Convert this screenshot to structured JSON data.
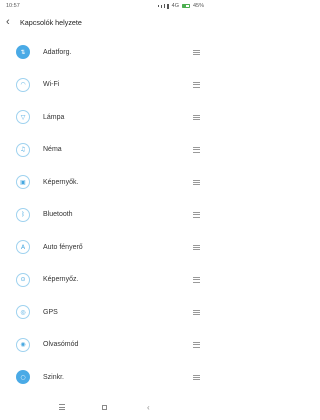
{
  "status_bar": {
    "time": "10:57",
    "network": "4G",
    "battery": "45%"
  },
  "header": {
    "back_icon": "chevron-left-icon",
    "title": "Kapcsolók helyzete"
  },
  "toggles": [
    {
      "label": "Adatforg.",
      "icon": "data-transfer-icon",
      "glyph": "⇅",
      "active": true
    },
    {
      "label": "Wi-Fi",
      "icon": "wifi-icon",
      "glyph": "◠",
      "active": false
    },
    {
      "label": "Lámpa",
      "icon": "flashlight-icon",
      "glyph": "▽",
      "active": false
    },
    {
      "label": "Néma",
      "icon": "mute-icon",
      "glyph": "♫",
      "active": false
    },
    {
      "label": "Képernyők.",
      "icon": "screenshot-icon",
      "glyph": "▣",
      "active": false
    },
    {
      "label": "Bluetooth",
      "icon": "bluetooth-icon",
      "glyph": "ᛒ",
      "active": false
    },
    {
      "label": "Auto fényerő",
      "icon": "auto-brightness-icon",
      "glyph": "A",
      "active": false
    },
    {
      "label": "Képernyőz.",
      "icon": "screen-lock-icon",
      "glyph": "⊙",
      "active": false
    },
    {
      "label": "GPS",
      "icon": "gps-icon",
      "glyph": "◎",
      "active": false
    },
    {
      "label": "Olvasómód",
      "icon": "reading-mode-icon",
      "glyph": "◉",
      "active": false
    },
    {
      "label": "Szinkr.",
      "icon": "sync-icon",
      "glyph": "○",
      "active": true
    }
  ],
  "nav_bar": {
    "menu_icon": "menu-icon",
    "home_icon": "home-icon",
    "back_icon": "back-icon"
  },
  "colors": {
    "accent": "#4aaae6",
    "icon_outline": "#9fd2ef",
    "battery": "#4caf50"
  }
}
